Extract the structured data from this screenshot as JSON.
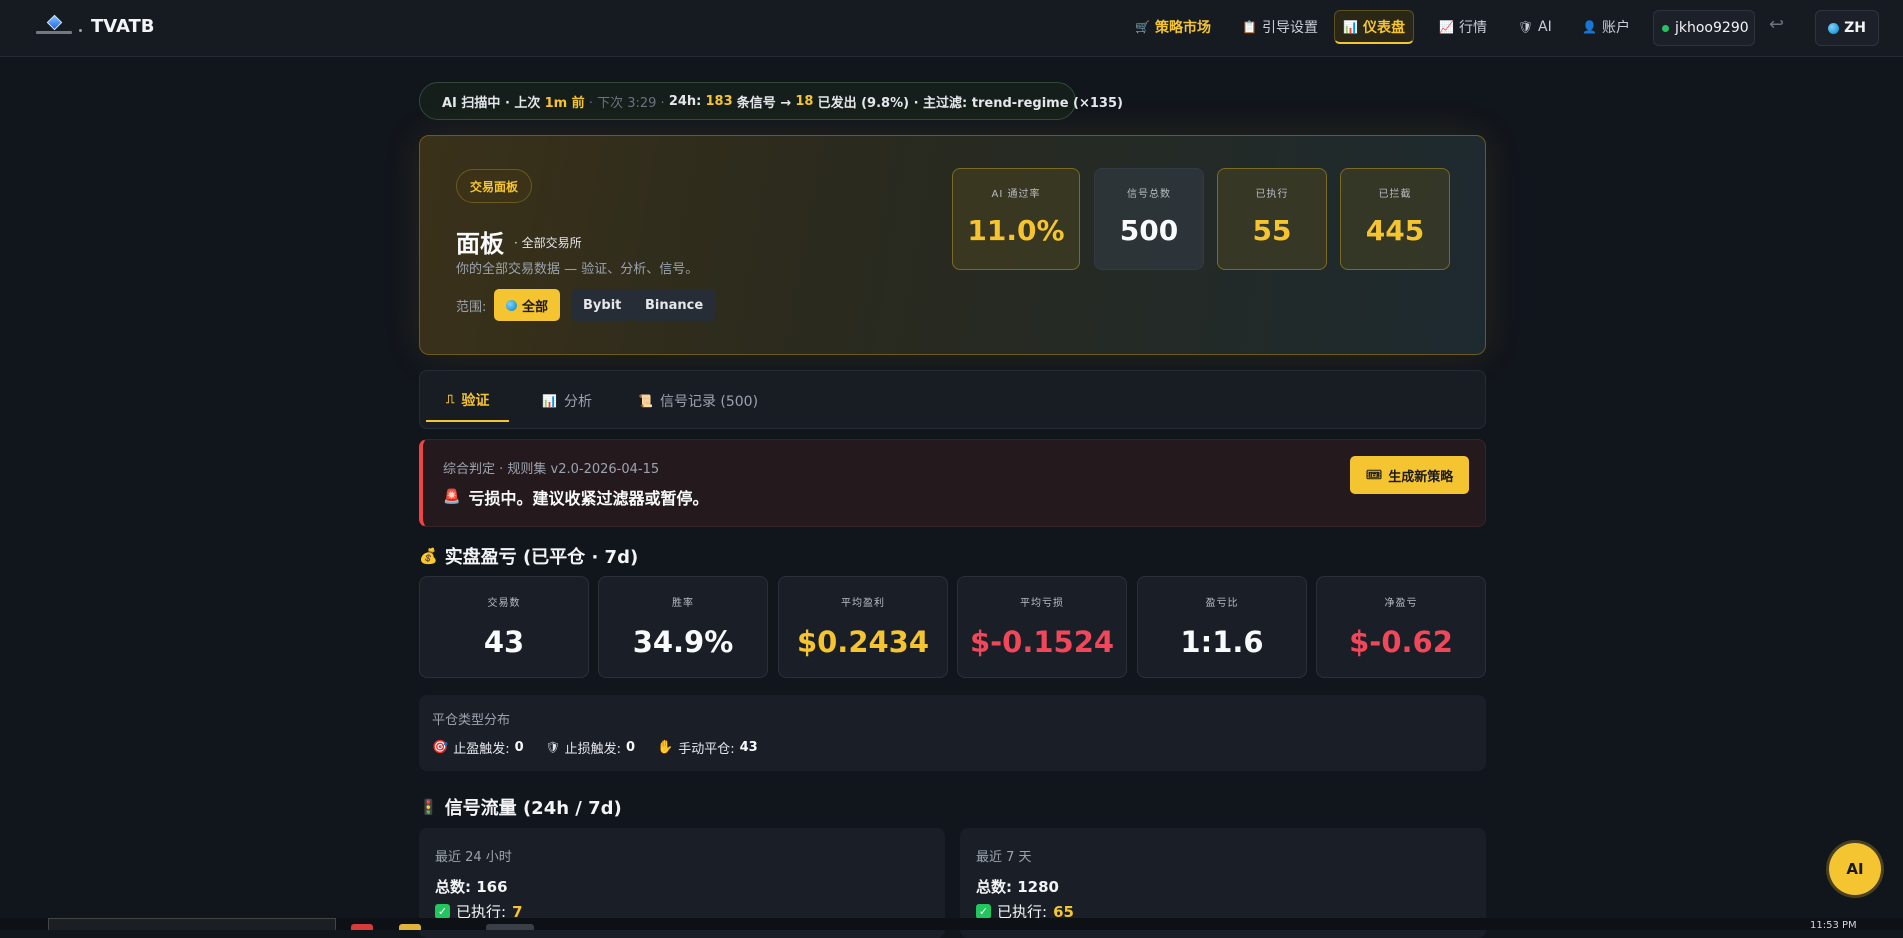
{
  "nav": {
    "brand": "TVATB",
    "items": [
      {
        "label": "策略市场",
        "icon": "cart-icon",
        "glyph": "🛒"
      },
      {
        "label": "引导设置",
        "icon": "clipboard-icon",
        "glyph": "📋"
      },
      {
        "label": "仪表盘",
        "icon": "bar-chart-icon",
        "glyph": "📊"
      },
      {
        "label": "行情",
        "icon": "line-chart-icon",
        "glyph": "📈"
      },
      {
        "label": "AI",
        "icon": "robot-icon",
        "glyph": "🛡"
      },
      {
        "label": "账户",
        "icon": "person-icon",
        "glyph": "👤"
      }
    ],
    "user": "jkhoo9290",
    "logout_glyph": "↩",
    "lang": "ZH"
  },
  "status": {
    "part1": "AI 扫描中 · 上次",
    "last_ago": "1m 前",
    "next": "· 下次 3:29 ·",
    "part2": "24h:",
    "signals": "183",
    "part3": "条信号 →",
    "sent": "18",
    "part4": "已发出 (9.8%) · 主过滤: trend-regime (×135)"
  },
  "hero": {
    "tag": "交易面板",
    "title": "面板",
    "subtitle": "· 全部交易所",
    "desc": "你的全部交易数据 — 验证、分析、信号。",
    "scope_label": "范围:",
    "scopes": [
      "全部",
      "Bybit",
      "Binance"
    ],
    "metrics": [
      {
        "label": "AI 通过率",
        "value": "11.0%"
      },
      {
        "label": "信号总数",
        "value": "500"
      },
      {
        "label": "已执行",
        "value": "55"
      },
      {
        "label": "已拦截",
        "value": "445"
      }
    ]
  },
  "tabs": [
    {
      "label": "验证",
      "glyph": "⎍"
    },
    {
      "label": "分析",
      "glyph": "📊"
    },
    {
      "label": "信号记录 (500)",
      "glyph": "📜"
    }
  ],
  "verdict": {
    "meta": "综合判定 · 规则集 v2.0-2026-04-15",
    "message": "亏损中。建议收紧过滤器或暂停。",
    "button": "生成新策略"
  },
  "pnl": {
    "heading": "实盘盈亏 (已平仓 · 7d)",
    "stats": [
      {
        "label": "交易数",
        "value": "43",
        "color": "#f9fafb"
      },
      {
        "label": "胜率",
        "value": "34.9%",
        "color": "#f9fafb"
      },
      {
        "label": "平均盈利",
        "value": "$0.2434",
        "color": "#f5c431"
      },
      {
        "label": "平均亏损",
        "value": "$-0.1524",
        "color": "#f0475a"
      },
      {
        "label": "盈亏比",
        "value": "1:1.6",
        "color": "#f9fafb"
      },
      {
        "label": "净盈亏",
        "value": "$-0.62",
        "color": "#f0475a"
      }
    ]
  },
  "distribution": {
    "title": "平仓类型分布",
    "items": [
      {
        "label": "止盈触发:",
        "value": "0",
        "icon": "target-icon",
        "glyph": "🎯"
      },
      {
        "label": "止损触发:",
        "value": "0",
        "icon": "shield-icon",
        "glyph": "🛡"
      },
      {
        "label": "手动平仓:",
        "value": "43",
        "icon": "hand-icon",
        "glyph": "✋"
      }
    ]
  },
  "flow": {
    "heading": "信号流量 (24h / 7d)",
    "cards": [
      {
        "title": "最近 24 小时",
        "total_label": "总数:",
        "total": "166",
        "exec_label": "已执行:",
        "exec": "7"
      },
      {
        "title": "最近 7 天",
        "total_label": "总数:",
        "total": "1280",
        "exec_label": "已执行:",
        "exec": "65"
      }
    ]
  },
  "fab": {
    "label": "AI"
  },
  "taskbar": {
    "clock": "11:53 PM"
  }
}
